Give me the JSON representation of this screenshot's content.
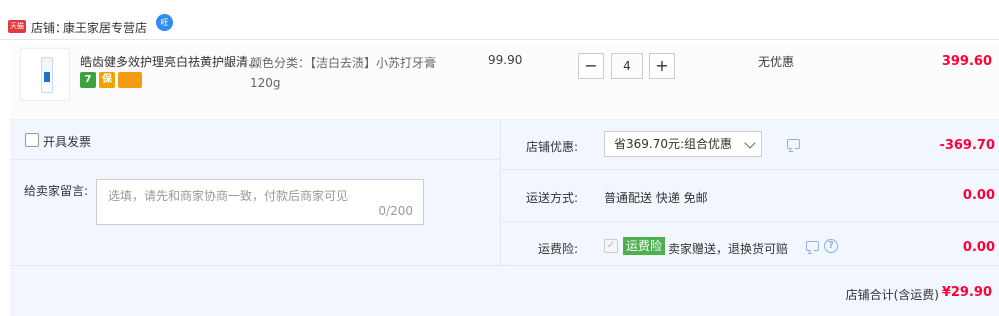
{
  "shop": {
    "badge": "天猫",
    "label": "店铺：",
    "name": "康王家居专营店",
    "ww_icon_text": "旺"
  },
  "item": {
    "title": "皓齿健多效护理亮白祛黄护龈清...",
    "sku_text": "颜色分类：【洁白去渍】小苏打牙膏120g",
    "unit_price": "99.90",
    "quantity": "4",
    "qty_minus": "−",
    "qty_plus": "+",
    "discount": "无优惠",
    "subtotal": "399.60",
    "service_icons": [
      "seven-day-return-icon",
      "guarantee-shield-icon",
      "credit-card-icon"
    ],
    "seven_day_glyph": "7",
    "shield_glyph": "保"
  },
  "invoice": {
    "label": "开具发票"
  },
  "message": {
    "label": "给卖家留言:",
    "placeholder": "选填，请先和商家协商一致，付款后商家可见",
    "count": "0/200"
  },
  "promotion": {
    "label": "店铺优惠:",
    "selected": "省369.70元:组合优惠",
    "amount": "-369.70"
  },
  "shipping": {
    "label": "运送方式:",
    "value": "普通配送 快递 免邮",
    "amount": "0.00"
  },
  "insurance": {
    "label": "运费险:",
    "tag": "运费险",
    "desc": "卖家赠送，退换货可赔",
    "amount": "0.00",
    "check_glyph": "✓",
    "help_glyph": "?"
  },
  "total": {
    "label": "店铺合计(含运费)",
    "amount": "¥29.90"
  },
  "colors": {
    "price_red": "#ff0036",
    "panel_bg": "#f2f7ff",
    "insurance_green": "#4caf50"
  }
}
